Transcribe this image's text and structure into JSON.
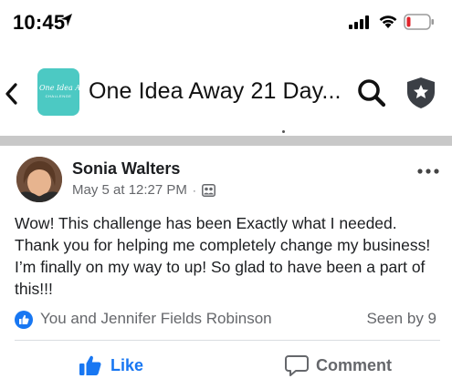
{
  "status_bar": {
    "time": "10:45",
    "icons": [
      "location-arrow-icon",
      "signal-icon",
      "wifi-icon",
      "battery-low-icon"
    ],
    "battery_color": "#e0242b"
  },
  "nav": {
    "group_title": "One Idea Away 21 Day...",
    "thumb_text": "One Idea Away",
    "thumb_subtext": "CHALLENGE",
    "thumb_color": "#4cc9c3",
    "icons": [
      "back-chevron-icon",
      "search-icon",
      "shield-star-icon"
    ]
  },
  "post": {
    "author": "Sonia Walters",
    "timestamp": "May 5 at 12:27 PM",
    "meta_separator": "·",
    "privacy_icon": "group-members-icon",
    "body": "Wow! This challenge has been Exactly what I needed. Thank you for helping me completely change my business! I’m finally on my way to up! So glad to have been a part of this!!!",
    "reactions": {
      "names": "You and Jennifer Fields Robinson",
      "seen_by": "Seen by 9"
    },
    "actions": {
      "like_label": "Like",
      "comment_label": "Comment"
    }
  },
  "colors": {
    "accent": "#1877f2",
    "secondary_text": "#65676b",
    "separator": "#c8c8c8"
  }
}
